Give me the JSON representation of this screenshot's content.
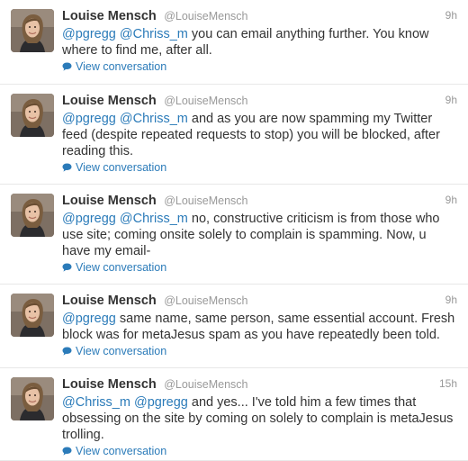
{
  "tweets": [
    {
      "fullname": "Louise Mensch",
      "username": "@LouiseMensch",
      "time": "9h",
      "mentions": [
        "@pgregg",
        "@Chriss_m"
      ],
      "text": "you can email anything further. You know where to find me, after all.",
      "view_label": "View conversation"
    },
    {
      "fullname": "Louise Mensch",
      "username": "@LouiseMensch",
      "time": "9h",
      "mentions": [
        "@pgregg",
        "@Chriss_m"
      ],
      "text": "and as you are now spamming my Twitter feed (despite repeated requests to stop) you will be blocked, after reading this.",
      "view_label": "View conversation"
    },
    {
      "fullname": "Louise Mensch",
      "username": "@LouiseMensch",
      "time": "9h",
      "mentions": [
        "@pgregg",
        "@Chriss_m"
      ],
      "text": "no, constructive criticism is from those who use site; coming onsite solely to complain is spamming. Now, u have my email-",
      "view_label": "View conversation"
    },
    {
      "fullname": "Louise Mensch",
      "username": "@LouiseMensch",
      "time": "9h",
      "mentions": [
        "@pgregg"
      ],
      "text": "same name, same person, same essential account. Fresh block was for metaJesus spam as you have repeatedly been told.",
      "view_label": "View conversation"
    },
    {
      "fullname": "Louise Mensch",
      "username": "@LouiseMensch",
      "time": "15h",
      "mentions": [
        "@Chriss_m",
        "@pgregg"
      ],
      "text": "and yes... I've told him a few times that obsessing on the site by coming on solely to complain is metaJesus trolling.",
      "view_label": "View conversation"
    }
  ],
  "colors": {
    "link": "#2b7bb9",
    "meta": "#999999",
    "text": "#333333"
  },
  "icons": {
    "avatar": "profile-photo",
    "view_conversation": "speech-bubble-icon"
  }
}
